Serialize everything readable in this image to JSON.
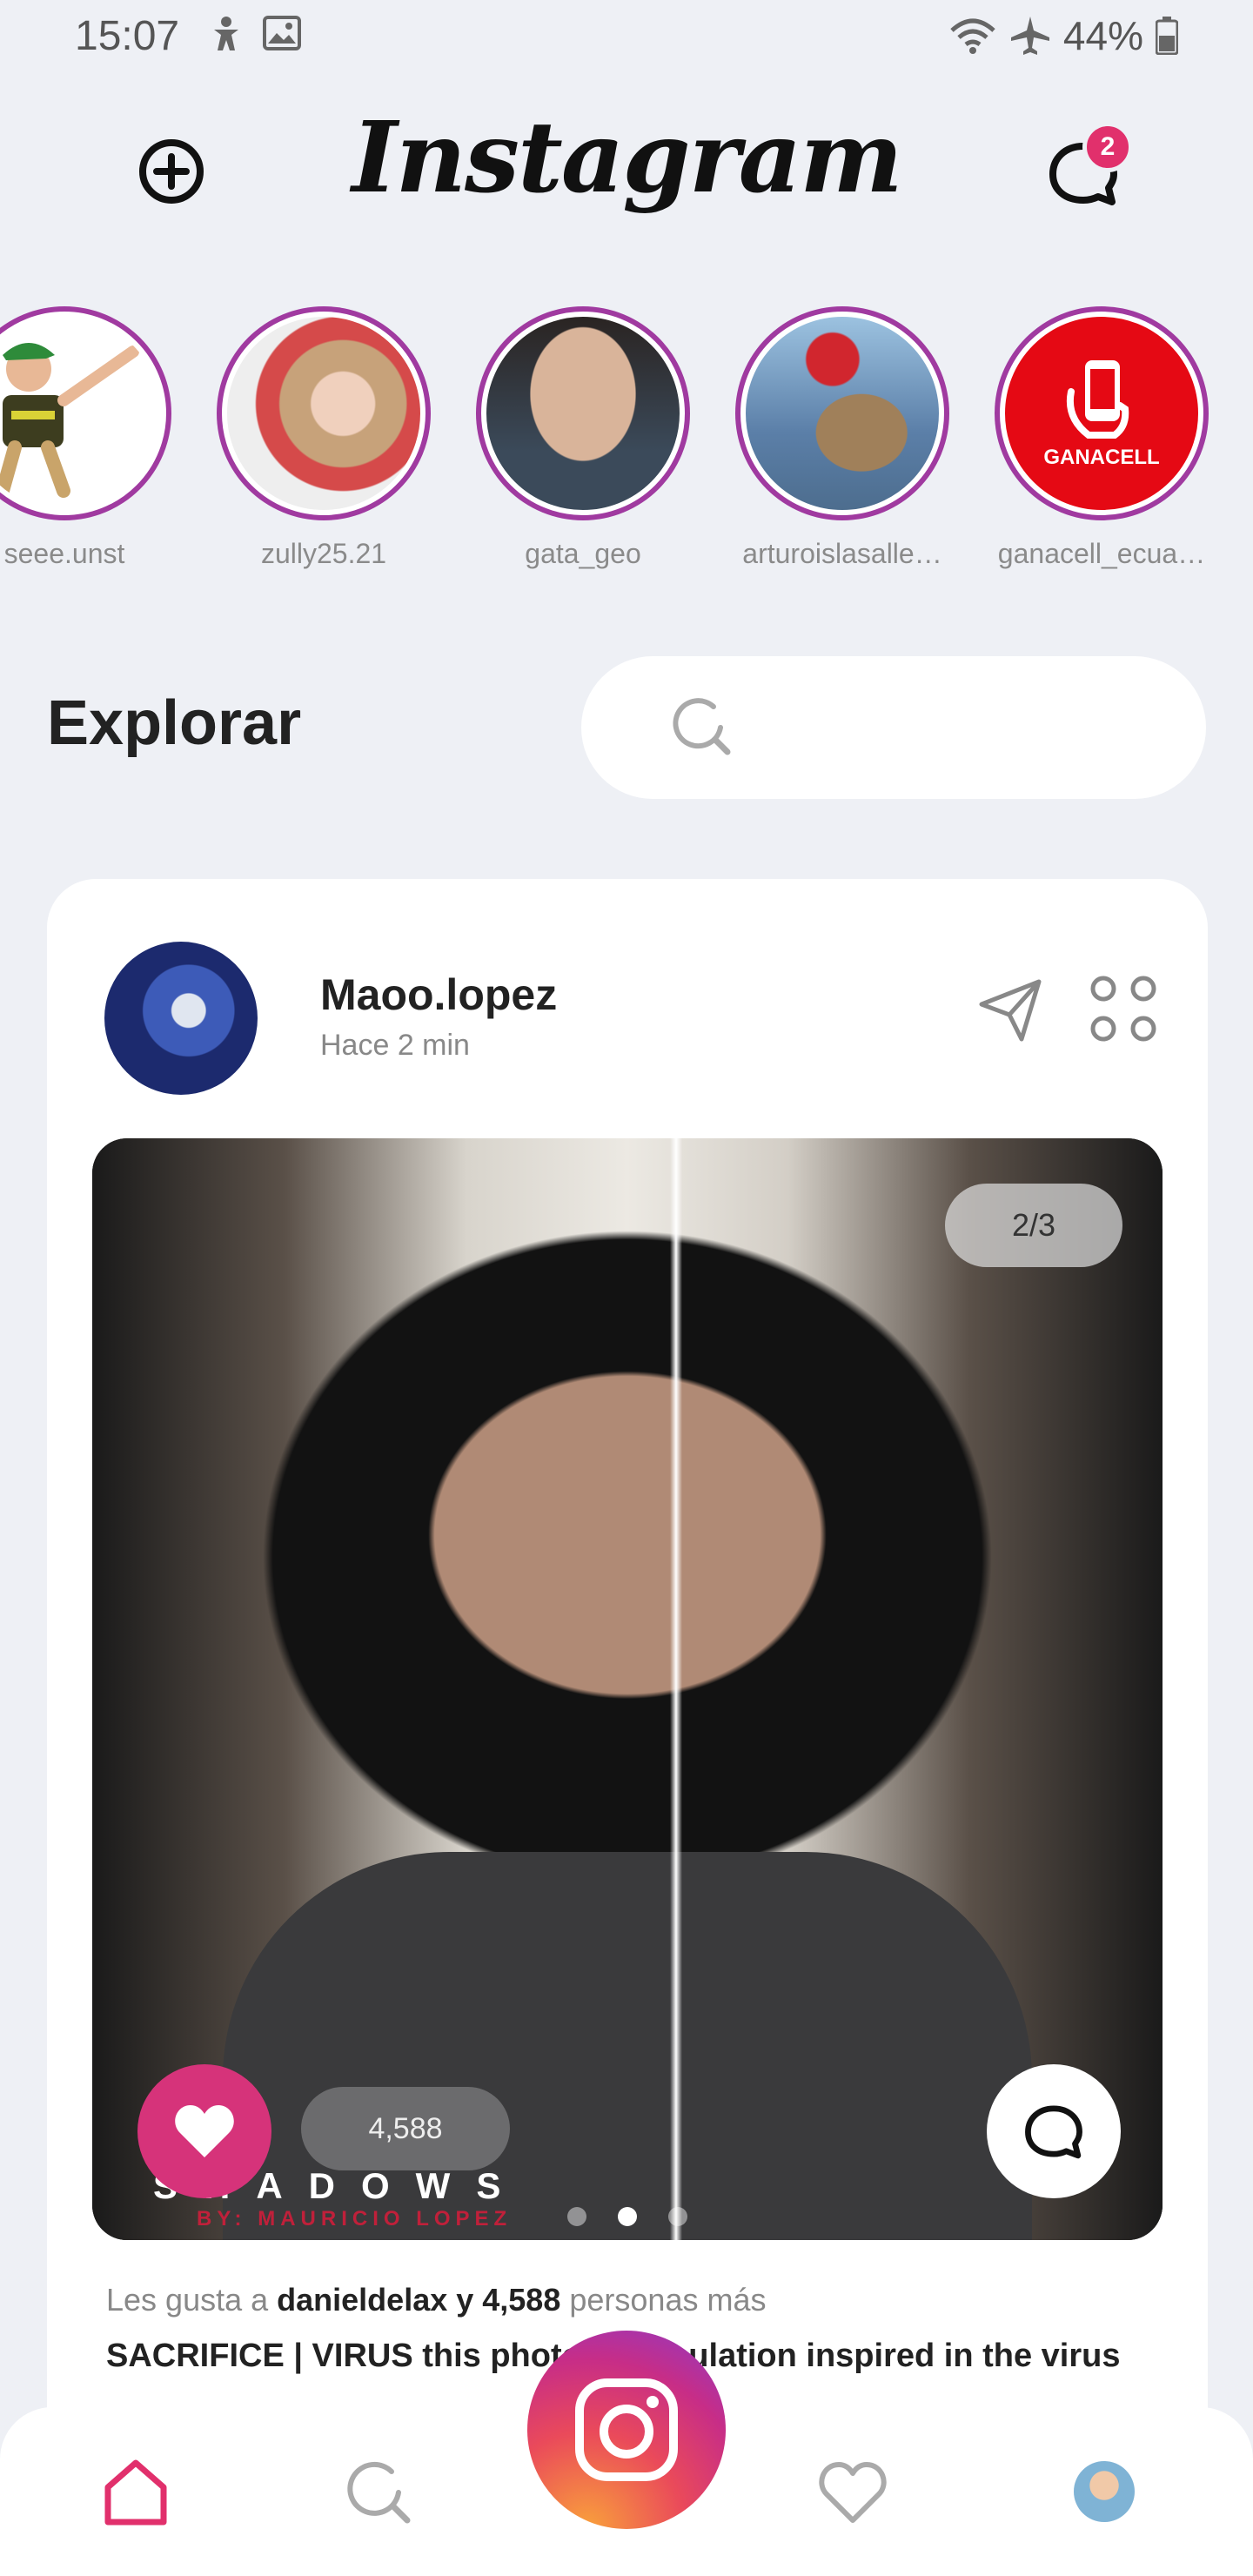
{
  "status_bar": {
    "time": "15:07",
    "battery": "44%",
    "icons": [
      "accessibility-icon",
      "gallery-icon",
      "wifi-icon",
      "airplane-mode-icon",
      "battery-icon"
    ]
  },
  "header": {
    "logo": "Instagram",
    "dm_badge": "2"
  },
  "stories": [
    {
      "name": "seee.unst",
      "color": "#ffffff"
    },
    {
      "name": "zully25.21",
      "color": "#e8c6b6"
    },
    {
      "name": "gata_geo",
      "color": "#5d4b45"
    },
    {
      "name": "arturoislasalle…",
      "color": "#6f8ca6"
    },
    {
      "name": "ganacell_ecua…",
      "color": "#e50914",
      "logo_text": "GANACELL"
    }
  ],
  "explore": {
    "title": "Explorar"
  },
  "post": {
    "username": "Maoo.lopez",
    "time": "Hace 2 min",
    "image_counter": "2/3",
    "like_count": "4,588",
    "watermark": "SHADOWS",
    "watermark_sub": "BY: MAURICIO LOPEZ",
    "likes_prefix": "Les gusta a",
    "likes_bold": "danieldelax y 4,588",
    "likes_suffix": "personas más",
    "caption": "SACRIFICE | VIRUS this photo manipulation inspired in the virus",
    "carousel": {
      "count": 3,
      "active": 1
    }
  },
  "colors": {
    "accent": "#e1306c",
    "story_ring": "#a03aa0",
    "background": "#eef0f5"
  }
}
